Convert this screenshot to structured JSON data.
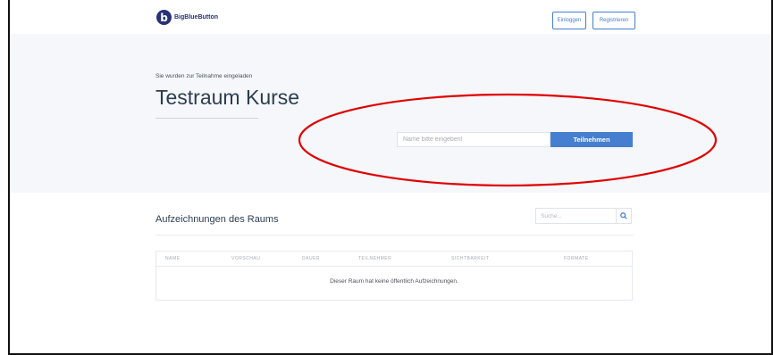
{
  "header": {
    "brand_name": "BigBlueButton",
    "logo_letter": "b",
    "login_label": "Einloggen",
    "register_label": "Registrieren"
  },
  "hero": {
    "invite_text": "Sie wurden zur Teilnahme eingeladen",
    "room_title": "Testraum Kurse",
    "name_placeholder": "Name bitte eingeben!",
    "join_label": "Teilnehmen"
  },
  "recordings": {
    "title": "Aufzeichnungen des Raums",
    "search_placeholder": "Suche...",
    "columns": [
      "NAME",
      "VORSCHAU",
      "DAUER",
      "TEILNEHMER",
      "SICHTBARKEIT",
      "FORMATE"
    ],
    "empty_message": "Dieser Raum hat keine öffentlich Aufzeichnungen."
  },
  "colors": {
    "primary": "#467fcf",
    "logo": "#283274",
    "hero_bg": "#f5f7fb",
    "annotation": "#e00000"
  }
}
